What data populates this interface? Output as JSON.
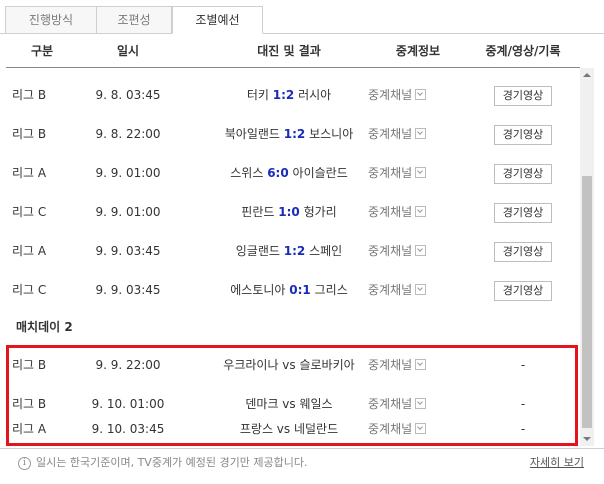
{
  "tabs": [
    {
      "label": "진행방식",
      "active": false
    },
    {
      "label": "조편성",
      "active": false
    },
    {
      "label": "조별예선",
      "active": true
    }
  ],
  "header": {
    "division": "구분",
    "datetime": "일시",
    "match": "대진 및 결과",
    "broadcast": "중계정보",
    "video": "중계/영상/기록"
  },
  "rows_top": [
    {
      "division": "리그 B",
      "datetime": "9. 8. 03:45",
      "home": "터키",
      "score": "1:2",
      "away": "러시아",
      "broadcast": "중계채널",
      "video": "경기영상"
    },
    {
      "division": "리그 B",
      "datetime": "9. 8. 22:00",
      "home": "북아일랜드",
      "score": "1:2",
      "away": "보스니아",
      "broadcast": "중계채널",
      "video": "경기영상"
    },
    {
      "division": "리그 A",
      "datetime": "9. 9. 01:00",
      "home": "스위스",
      "score": "6:0",
      "away": "아이슬란드",
      "broadcast": "중계채널",
      "video": "경기영상"
    },
    {
      "division": "리그 C",
      "datetime": "9. 9. 01:00",
      "home": "핀란드",
      "score": "1:0",
      "away": "헝가리",
      "broadcast": "중계채널",
      "video": "경기영상"
    },
    {
      "division": "리그 A",
      "datetime": "9. 9. 03:45",
      "home": "잉글랜드",
      "score": "1:2",
      "away": "스페인",
      "broadcast": "중계채널",
      "video": "경기영상"
    },
    {
      "division": "리그 C",
      "datetime": "9. 9. 03:45",
      "home": "에스토니아",
      "score": "0:1",
      "away": "그리스",
      "broadcast": "중계채널",
      "video": "경기영상"
    }
  ],
  "section": {
    "title": "매치데이 2"
  },
  "rows_bottom": [
    {
      "division": "리그 B",
      "datetime": "9. 9. 22:00",
      "match": "우크라이나 vs 슬로바키아",
      "broadcast": "중계채널",
      "video": "-"
    },
    {
      "division": "리그 B",
      "datetime": "9. 10. 01:00",
      "match": "덴마크 vs 웨일스",
      "broadcast": "중계채널",
      "video": "-"
    },
    {
      "division": "리그 A",
      "datetime": "9. 10. 03:45",
      "match": "프랑스 vs 네덜란드",
      "broadcast": "중계채널",
      "video": "-"
    }
  ],
  "footer": {
    "icon": "info-icon",
    "icon_glyph": "i",
    "note": "일시는 한국기준이며, TV중계가 예정된 경기만 제공합니다.",
    "link": "자세히 보기"
  },
  "colors": {
    "score": "#1a2bb8",
    "highlight": "#e3141b"
  }
}
